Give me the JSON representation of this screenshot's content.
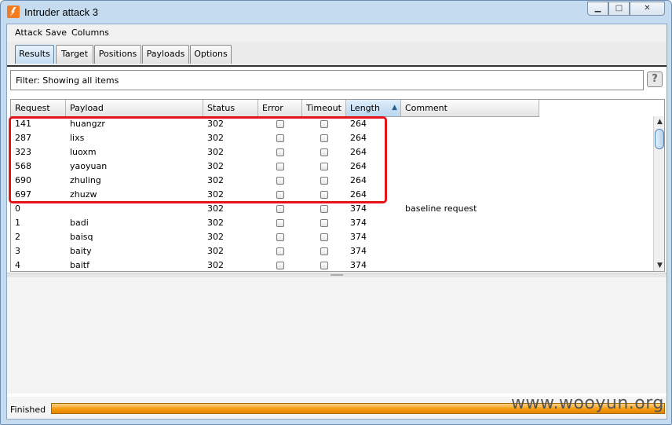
{
  "window": {
    "title": "Intruder attack 3"
  },
  "menu": [
    "Attack",
    "Save",
    "Columns"
  ],
  "tabs": [
    {
      "label": "Results",
      "active": true
    },
    {
      "label": "Target",
      "active": false
    },
    {
      "label": "Positions",
      "active": false
    },
    {
      "label": "Payloads",
      "active": false
    },
    {
      "label": "Options",
      "active": false
    }
  ],
  "filter": {
    "text": "Filter:  Showing all items",
    "help": "?"
  },
  "table": {
    "columns": [
      "Request",
      "Payload",
      "Status",
      "Error",
      "Timeout",
      "Length",
      "Comment"
    ],
    "sorted_column": "Length",
    "rows": [
      {
        "request": "141",
        "payload": "huangzr",
        "status": "302",
        "length": "264",
        "comment": ""
      },
      {
        "request": "287",
        "payload": "lixs",
        "status": "302",
        "length": "264",
        "comment": ""
      },
      {
        "request": "323",
        "payload": "luoxm",
        "status": "302",
        "length": "264",
        "comment": ""
      },
      {
        "request": "568",
        "payload": "yaoyuan",
        "status": "302",
        "length": "264",
        "comment": ""
      },
      {
        "request": "690",
        "payload": "zhuling",
        "status": "302",
        "length": "264",
        "comment": ""
      },
      {
        "request": "697",
        "payload": "zhuzw",
        "status": "302",
        "length": "264",
        "comment": ""
      },
      {
        "request": "0",
        "payload": "",
        "status": "302",
        "length": "374",
        "comment": "baseline request"
      },
      {
        "request": "1",
        "payload": "badi",
        "status": "302",
        "length": "374",
        "comment": ""
      },
      {
        "request": "2",
        "payload": "baisq",
        "status": "302",
        "length": "374",
        "comment": ""
      },
      {
        "request": "3",
        "payload": "baity",
        "status": "302",
        "length": "374",
        "comment": ""
      },
      {
        "request": "4",
        "payload": "baitf",
        "status": "302",
        "length": "374",
        "comment": ""
      }
    ]
  },
  "status": {
    "text": "Finished",
    "progress": 1.0
  },
  "watermark": "www.wooyun.org",
  "colors": {
    "highlight": "#e5131a",
    "progress": "#f59a0c",
    "active_tab": "#c4ddf2"
  }
}
